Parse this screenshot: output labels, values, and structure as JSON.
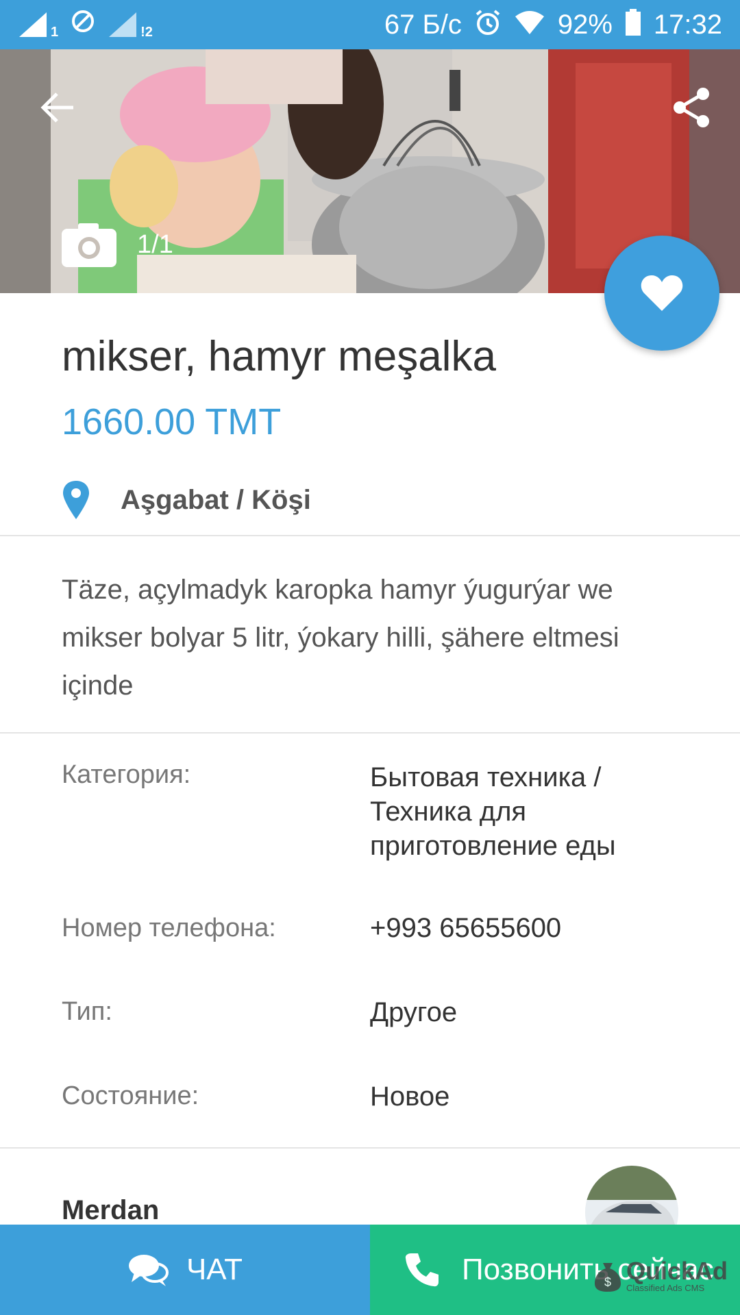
{
  "status_bar": {
    "network_speed": "67 Б/с",
    "battery": "92%",
    "time": "17:32",
    "sim1_label": "1",
    "sim2_label": "!2"
  },
  "gallery": {
    "counter": "1/1"
  },
  "listing": {
    "title": "mikser, hamyr meşalka",
    "price": "1660.00 TMT",
    "location": "Aşgabat / Köşi",
    "description": "Täze, açylmadyk karopka hamyr ýugurýar we mikser bolyar 5 litr, ýokary hilli, şähere eltmesi içinde"
  },
  "details": [
    {
      "label": "Категория:",
      "value": "Бытовая техника / Техника для приготовление еды"
    },
    {
      "label": "Номер телефона:",
      "value": "+993 65655600"
    },
    {
      "label": "Тип:",
      "value": "Другое"
    },
    {
      "label": "Состояние:",
      "value": "Новое"
    }
  ],
  "seller": {
    "name": "Merdan"
  },
  "actions": {
    "chat_label": "ЧАТ",
    "call_label": "Позвонить сейчас"
  },
  "watermark": {
    "name": "QuickAd",
    "subtitle": "Classified Ads CMS"
  },
  "colors": {
    "primary": "#3d9fda",
    "call_green": "#1fbf85",
    "price": "#3d9fda"
  }
}
